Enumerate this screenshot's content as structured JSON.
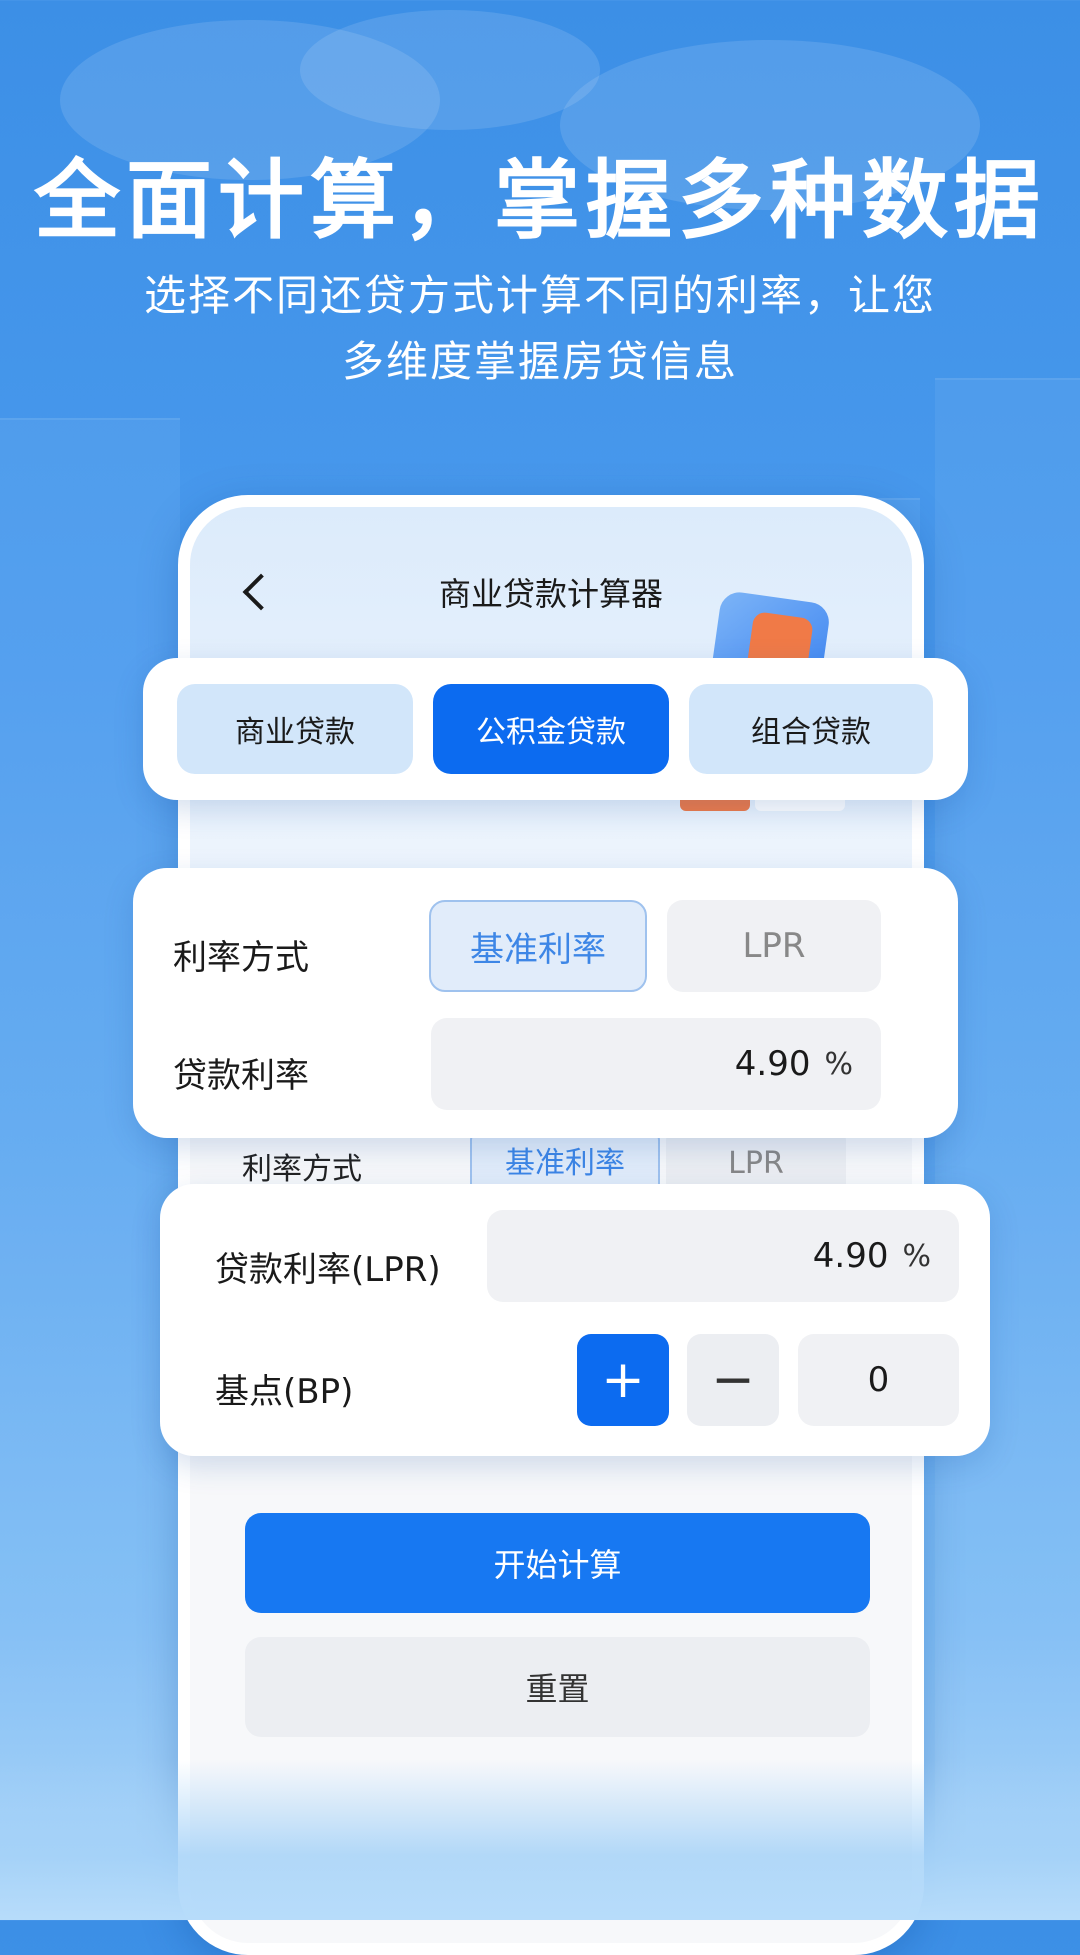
{
  "headline": "全面计算，掌握多种数据",
  "subline": [
    "选择不同还贷方式计算不同的利率，让您",
    "多维度掌握房贷信息"
  ],
  "phone": {
    "title": "商业贷款计算器",
    "ghost_row": {
      "label": "利率方式",
      "option_selected": "基准利率",
      "option_other": "LPR"
    },
    "primary_button": "开始计算",
    "secondary_button": "重置"
  },
  "tabs": [
    "商业贷款",
    "公积金贷款",
    "组合贷款"
  ],
  "active_tab_index": 1,
  "rate_card": {
    "method_label": "利率方式",
    "method_options": [
      "基准利率",
      "LPR"
    ],
    "selected_method": "基准利率",
    "rate_label": "贷款利率",
    "rate_value": "4.90",
    "rate_unit": "%"
  },
  "lpr_card": {
    "rate_label": "贷款利率(LPR)",
    "rate_value": "4.90",
    "rate_unit": "%",
    "bp_label": "基点(BP)",
    "bp_value": "0",
    "plus_symbol": "+",
    "minus_symbol": "−"
  },
  "colors": {
    "accent": "#0c6bf0",
    "tab_inactive": "#d2e6fa",
    "selected_border": "#9fc2ee"
  }
}
